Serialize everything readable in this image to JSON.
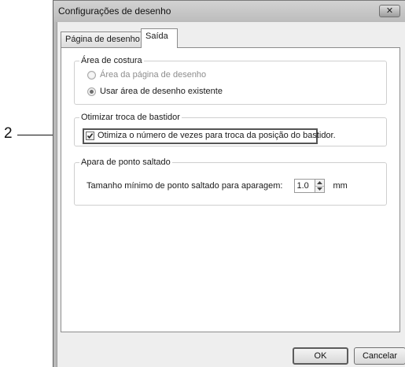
{
  "callout": {
    "number": "2"
  },
  "dialog": {
    "title": "Configurações de desenho",
    "close_glyph": "✕"
  },
  "tabs": [
    {
      "label": "Página de desenho",
      "active": false
    },
    {
      "label": "Saída",
      "active": true
    }
  ],
  "sewing_area": {
    "legend": "Área de costura",
    "options": [
      {
        "label": "Área da página de desenho",
        "selected": false,
        "enabled": false
      },
      {
        "label": "Usar área de desenho existente",
        "selected": true,
        "enabled": true
      }
    ]
  },
  "hoop_change": {
    "legend": "Otimizar troca de bastidor",
    "checkbox_label": "Otimiza o número de vezes para troca da posição do bastidor.",
    "checked": true
  },
  "jump_stitch_trim": {
    "legend": "Apara de ponto saltado",
    "field_label": "Tamanho mínimo de ponto saltado para aparagem:",
    "value": "1.0",
    "unit": "mm"
  },
  "buttons": {
    "ok": "OK",
    "cancel": "Cancelar"
  },
  "icons": {
    "close": "close-icon",
    "checkmark": "checkmark-icon",
    "spin_up": "spin-up-icon",
    "spin_down": "spin-down-icon"
  }
}
